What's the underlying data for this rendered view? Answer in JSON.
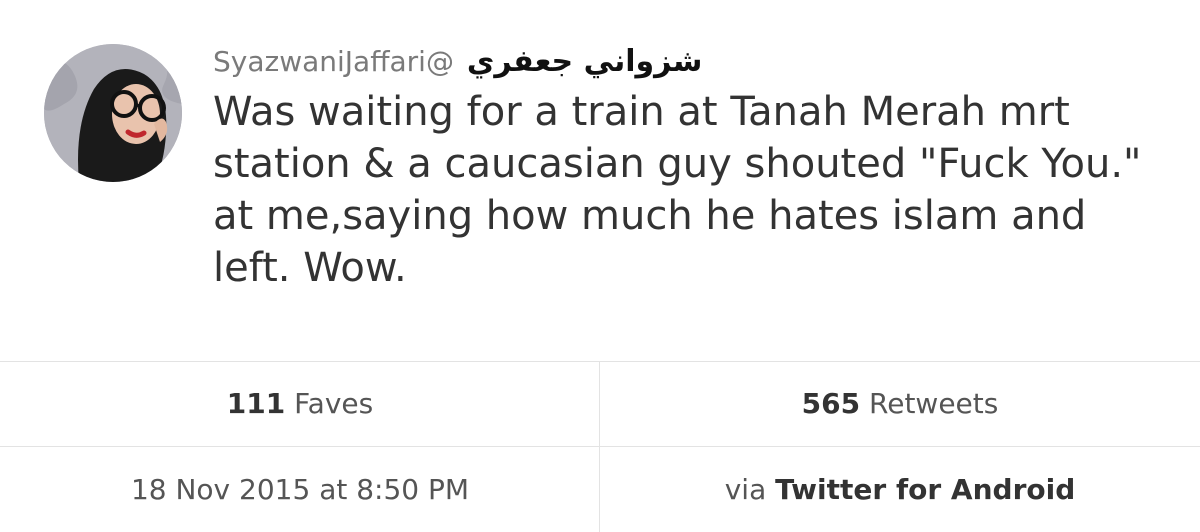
{
  "tweet": {
    "handle": "SyazwaniJaffari@",
    "display_name": "شزواني جعفري",
    "text": "Was waiting for a train at Tanah Merah mrt station & a caucasian guy shouted \"Fuck You.\" at me,saying how much he hates islam and left. Wow.",
    "avatar_icon": "user-avatar"
  },
  "stats": {
    "faves_count": "111",
    "faves_label": "Faves",
    "retweets_count": "565",
    "retweets_label": "Retweets"
  },
  "meta": {
    "timestamp": "18 Nov 2015 at 8:50 PM",
    "via_prefix": "via",
    "client": "Twitter for Android"
  },
  "colors": {
    "text": "#333333",
    "muted": "#7a7a7a",
    "divider": "#e3e3e3"
  }
}
